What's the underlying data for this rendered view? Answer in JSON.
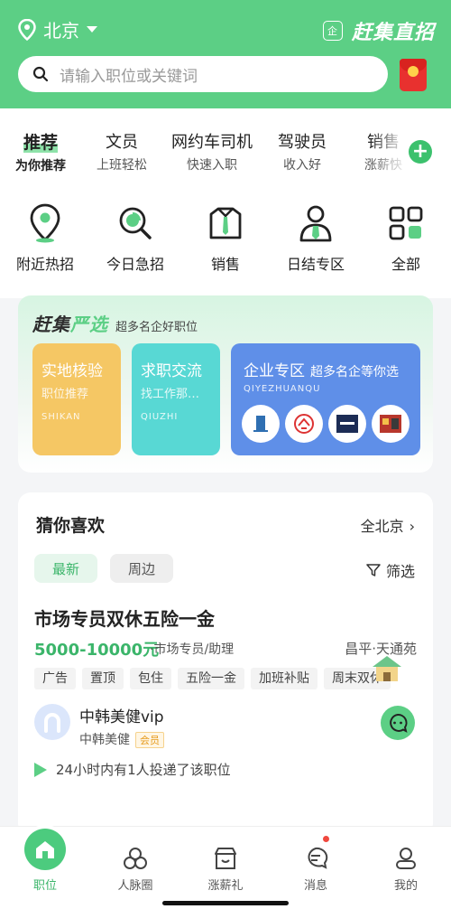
{
  "header": {
    "city": "北京",
    "brand": "赶集直招",
    "brand_badge": "企",
    "search_placeholder": "请输入职位或关键词"
  },
  "tabs": [
    {
      "title": "推荐",
      "sub": "为你推荐"
    },
    {
      "title": "文员",
      "sub": "上班轻松"
    },
    {
      "title": "网约车司机",
      "sub": "快速入职"
    },
    {
      "title": "驾驶员",
      "sub": "收入好"
    },
    {
      "title": "销售",
      "sub": "涨薪快"
    }
  ],
  "categories": [
    {
      "label": "附近热招",
      "icon": "location-icon"
    },
    {
      "label": "今日急招",
      "icon": "clock-search-icon"
    },
    {
      "label": "销售",
      "icon": "shirt-icon"
    },
    {
      "label": "日结专区",
      "icon": "person-tie-icon"
    },
    {
      "label": "全部",
      "icon": "grid-icon"
    }
  ],
  "yanxuan": {
    "logo_a": "赶集",
    "logo_b": "严选",
    "subtitle": "超多名企好职位",
    "cards": [
      {
        "title": "实地核验",
        "sub": "职位推荐",
        "en": "SHIKAN"
      },
      {
        "title": "求职交流",
        "sub": "找工作那…",
        "en": "QIUZHI"
      },
      {
        "title": "企业专区",
        "sub": "超多名企等你选",
        "en": "QIYEZHUANQU"
      }
    ]
  },
  "guess": {
    "title": "猜你喜欢",
    "city": "全北京",
    "chip_new": "最新",
    "chip_near": "周边",
    "filter": "筛选",
    "job": {
      "title": "市场专员双休五险一金",
      "salary": "5000-10000元",
      "type": "·市场专员/助理",
      "location": "昌平·天通苑",
      "tags": [
        "广告",
        "置顶",
        "包住",
        "五险一金",
        "加班补贴",
        "周末双休"
      ],
      "company": "中韩美健vip",
      "company_name": "中韩美健",
      "vip_badge": "会员",
      "notice": "24小时内有1人投递了该职位"
    }
  },
  "nav": [
    {
      "label": "职位",
      "icon": "home-icon"
    },
    {
      "label": "人脉圈",
      "icon": "circles-icon"
    },
    {
      "label": "涨薪礼",
      "icon": "shop-icon"
    },
    {
      "label": "消息",
      "icon": "message-icon"
    },
    {
      "label": "我的",
      "icon": "user-icon"
    }
  ],
  "colors": {
    "brand_green": "#5ccf85",
    "accent_green": "#3bb56a"
  }
}
